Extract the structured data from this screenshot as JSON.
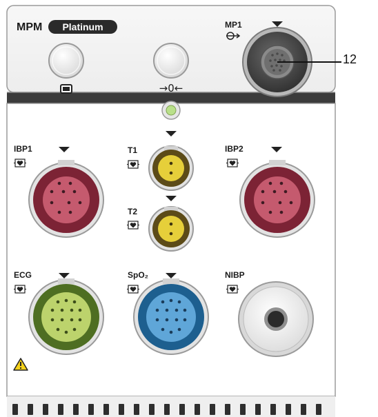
{
  "module": {
    "brand": "MPM",
    "model_badge": "Platinum",
    "zero_symbol": "→0←"
  },
  "connectors": {
    "mp1": {
      "label": "MP1"
    },
    "ibp1": {
      "label": "IBP1"
    },
    "t1": {
      "label": "T1"
    },
    "t2": {
      "label": "T2"
    },
    "ibp2": {
      "label": "IBP2"
    },
    "ecg": {
      "label": "ECG"
    },
    "spo2": {
      "label": "SpO₂"
    },
    "nibp": {
      "label": "NIBP"
    }
  },
  "callout": {
    "number": "12",
    "target": "mp1"
  },
  "colors": {
    "ibp": "#8a2a3a",
    "temp": "#e2c82e",
    "ecg": "#6f9a2a",
    "spo2": "#2f7fb8",
    "nibp": "#f2f2f2",
    "mp1": "#3a3a3a",
    "panel": "#f4f4f4",
    "bezel": "#3b3b3b",
    "led": "#b9e08a"
  },
  "icons": [
    "heart-icon",
    "display-icon",
    "warning-icon",
    "arrow-down-icon",
    "connection-icon"
  ]
}
